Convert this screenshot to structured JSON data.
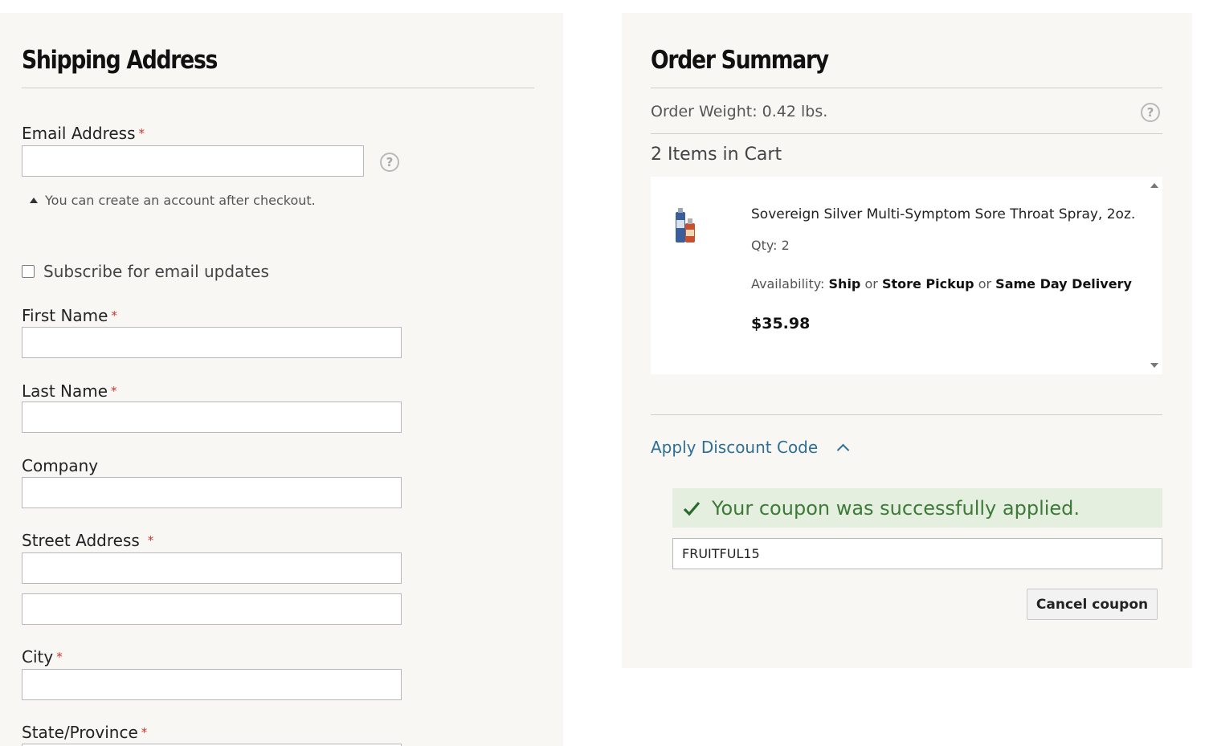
{
  "shipping": {
    "title": "Shipping Address",
    "email_label": "Email Address",
    "email_value": "",
    "help_symbol": "?",
    "account_note": "You can create an account after checkout.",
    "subscribe_label": "Subscribe for email updates",
    "subscribe_checked": false,
    "first_name_label": "First Name",
    "last_name_label": "Last Name",
    "company_label": "Company",
    "street_label": "Street Address",
    "city_label": "City",
    "state_label": "State/Province",
    "required_mark": "*"
  },
  "summary": {
    "title": "Order Summary",
    "weight": "Order Weight: 0.42 lbs.",
    "items_count": "2 Items in Cart",
    "item": {
      "name": "Sovereign Silver Multi-Symptom Sore Throat Spray, 2oz.",
      "qty": "Qty: 2",
      "availability_label": "Availability:",
      "option_ship": "Ship",
      "or_1": "or",
      "option_pickup": "Store Pickup",
      "or_2": "or",
      "option_delivery": "Same Day Delivery",
      "price": "$35.98"
    },
    "discount_toggle": "Apply Discount Code",
    "coupon_success": "Your coupon was successfully applied.",
    "coupon_code": "FRUITFUL15",
    "cancel_coupon": "Cancel coupon"
  },
  "colors": {
    "panel_bg": "#f8f7f4",
    "link": "#2e6f96",
    "success_bg": "#e5efe0",
    "success_text": "#3d7a38",
    "required": "#d0342c"
  }
}
